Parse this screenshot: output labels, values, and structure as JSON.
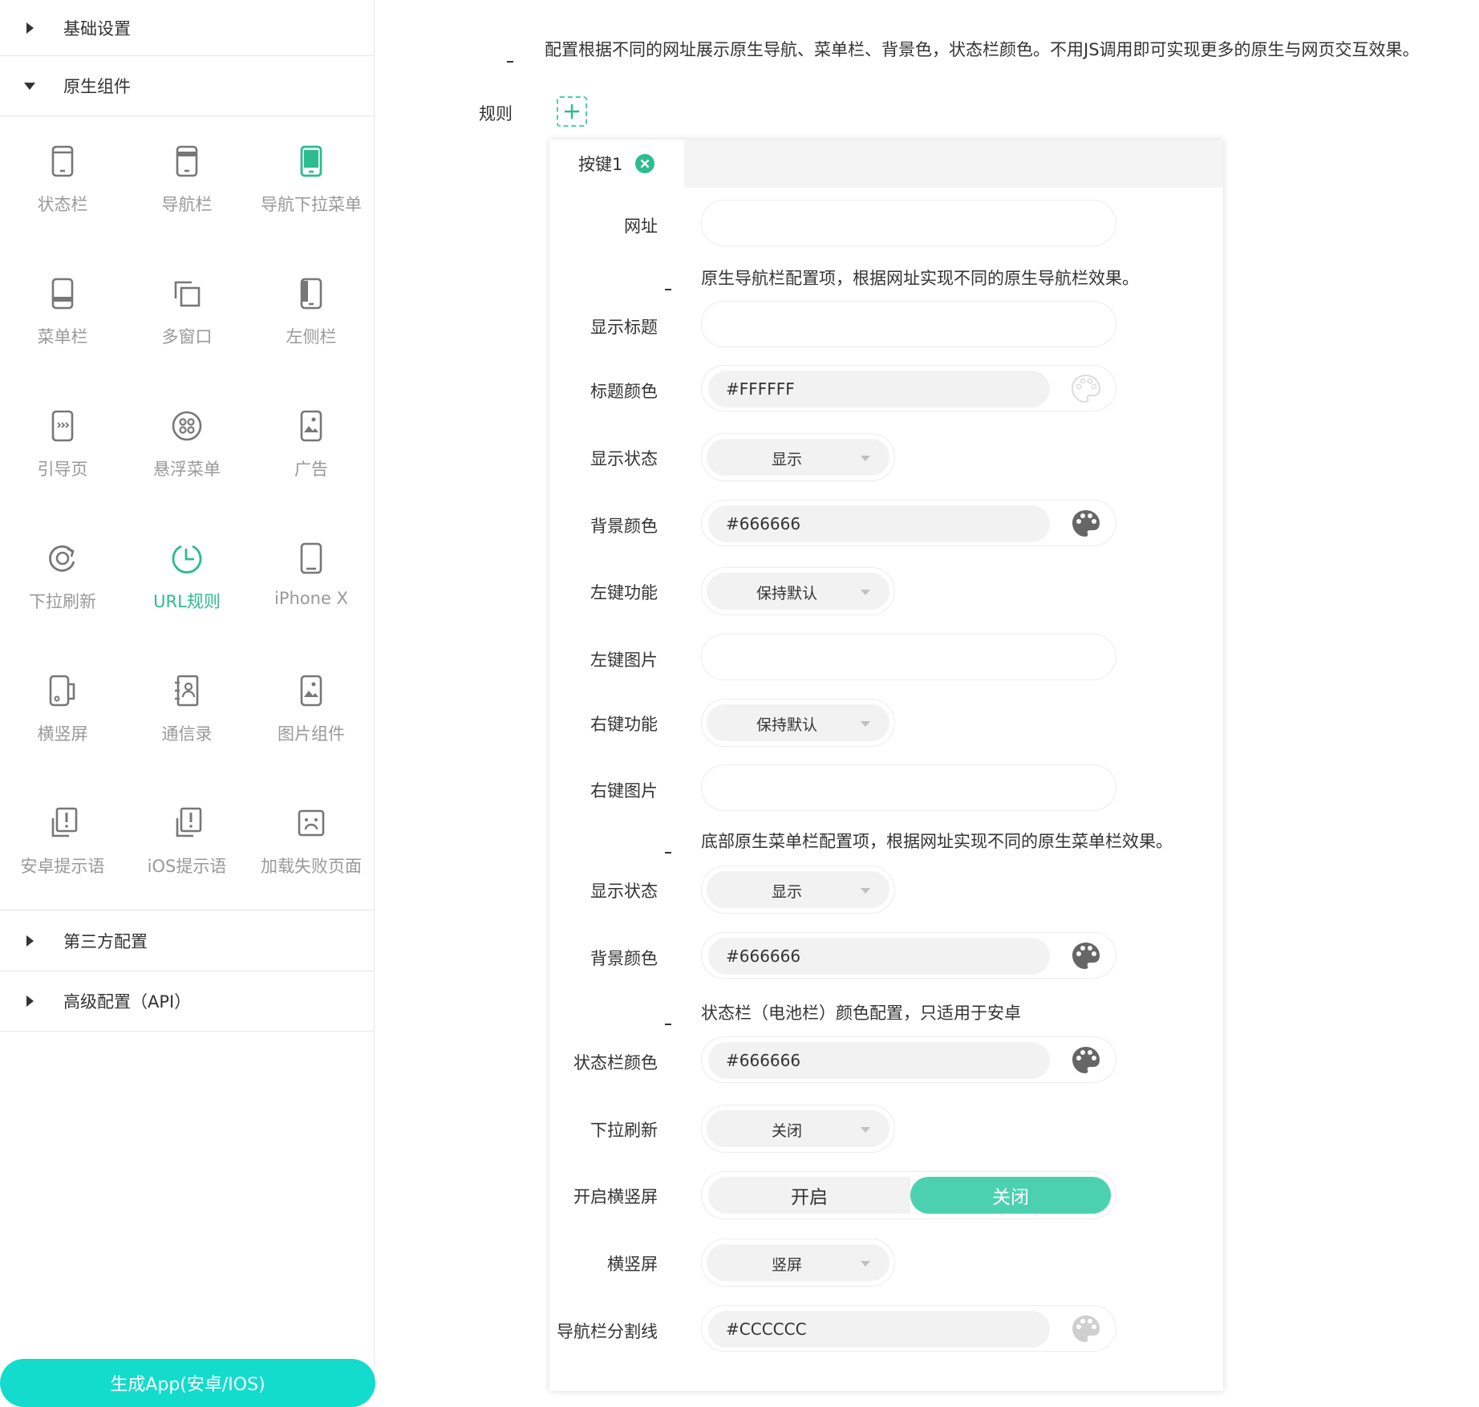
{
  "sidebar": {
    "sections": {
      "basic": "基础设置",
      "native": "原生组件",
      "third_party": "第三方配置",
      "advanced": "高级配置（API）"
    },
    "items": [
      {
        "label": "状态栏",
        "icon": "phone-status-bar-icon"
      },
      {
        "label": "导航栏",
        "icon": "phone-nav-bar-icon"
      },
      {
        "label": "导航下拉菜单",
        "icon": "phone-dropdown-icon"
      },
      {
        "label": "菜单栏",
        "icon": "phone-menu-bar-icon"
      },
      {
        "label": "多窗口",
        "icon": "multi-window-icon"
      },
      {
        "label": "左侧栏",
        "icon": "phone-left-sidebar-icon"
      },
      {
        "label": "引导页",
        "icon": "guide-page-icon"
      },
      {
        "label": "悬浮菜单",
        "icon": "floating-menu-icon"
      },
      {
        "label": "广告",
        "icon": "ad-image-icon"
      },
      {
        "label": "下拉刷新",
        "icon": "refresh-icon"
      },
      {
        "label": "URL规则",
        "icon": "url-rule-clock-icon"
      },
      {
        "label": "iPhone X",
        "icon": "iphone-x-icon"
      },
      {
        "label": "横竖屏",
        "icon": "rotate-screen-icon"
      },
      {
        "label": "通信录",
        "icon": "contacts-icon"
      },
      {
        "label": "图片组件",
        "icon": "image-component-icon"
      },
      {
        "label": "安卓提示语",
        "icon": "android-alert-icon"
      },
      {
        "label": "iOS提示语",
        "icon": "ios-alert-icon"
      },
      {
        "label": "加载失败页面",
        "icon": "load-fail-face-icon"
      }
    ],
    "active_item": "URL规则",
    "generate_button": "生成App(安卓/IOS)"
  },
  "main": {
    "intro": "配置根据不同的网址展示原生导航、菜单栏、背景色，状态栏颜色。不用JS调用即可实现更多的原生与网页交互效果。",
    "rule_label": "规则",
    "tab_label": "按键1",
    "url_label": "网址",
    "url_value": "",
    "nav_note": "原生导航栏配置项，根据网址实现不同的原生导航栏效果。",
    "show_title_label": "显示标题",
    "show_title_value": "",
    "title_color_label": "标题颜色",
    "title_color_value": "#FFFFFF",
    "nav_display_label": "显示状态",
    "nav_display_value": "显示",
    "nav_bg_label": "背景颜色",
    "nav_bg_value": "#666666",
    "left_func_label": "左键功能",
    "left_func_value": "保持默认",
    "left_img_label": "左键图片",
    "left_img_value": "",
    "right_func_label": "右键功能",
    "right_func_value": "保持默认",
    "right_img_label": "右键图片",
    "right_img_value": "",
    "menu_note": "底部原生菜单栏配置项，根据网址实现不同的原生菜单栏效果。",
    "menu_display_label": "显示状态",
    "menu_display_value": "显示",
    "menu_bg_label": "背景颜色",
    "menu_bg_value": "#666666",
    "status_note": "状态栏（电池栏）颜色配置，只适用于安卓",
    "status_color_label": "状态栏颜色",
    "status_color_value": "#666666",
    "pull_refresh_label": "下拉刷新",
    "pull_refresh_value": "关闭",
    "rotate_label": "开启横竖屏",
    "rotate_on": "开启",
    "rotate_off": "关闭",
    "orientation_label": "横竖屏",
    "orientation_value": "竖屏",
    "nav_divider_label": "导航栏分割线",
    "nav_divider_value": "#CCCCCC"
  },
  "colors": {
    "accent": "#2bbd8d",
    "toggle_active": "#4cd1b0",
    "generate_button": "#13dccc"
  }
}
